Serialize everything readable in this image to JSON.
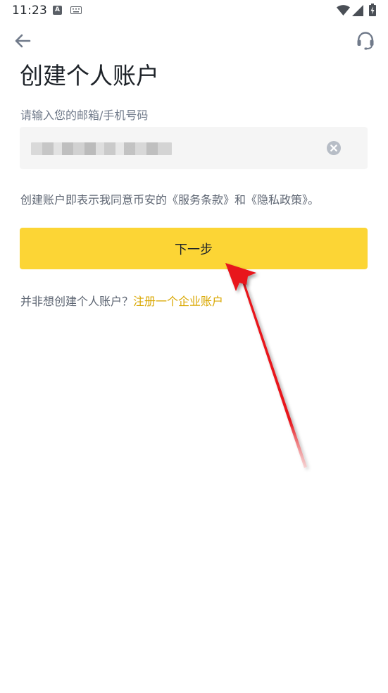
{
  "status_bar": {
    "time": "11:23",
    "icons": [
      "a-notification-icon",
      "keyboard-icon",
      "wifi-icon",
      "signal-icon",
      "battery-icon"
    ]
  },
  "header": {
    "back_icon": "arrow-left-icon",
    "support_icon": "headset-icon"
  },
  "page": {
    "title": "创建个人账户",
    "field_label": "请输入您的邮箱/手机号码",
    "input_value": "••••••••••••••••",
    "agreement_prefix": "创建账户即表示我同意币安的",
    "terms_link": "《服务条款》",
    "agreement_and": "和",
    "privacy_link": "《隐私政策》",
    "agreement_suffix": "。",
    "next_button": "下一步",
    "business_question": "并非想创建个人账户？",
    "business_link": "注册一个企业账户"
  },
  "colors": {
    "accent": "#FCD535",
    "link": "#D9A700",
    "annotation_arrow": "#E8141B"
  }
}
